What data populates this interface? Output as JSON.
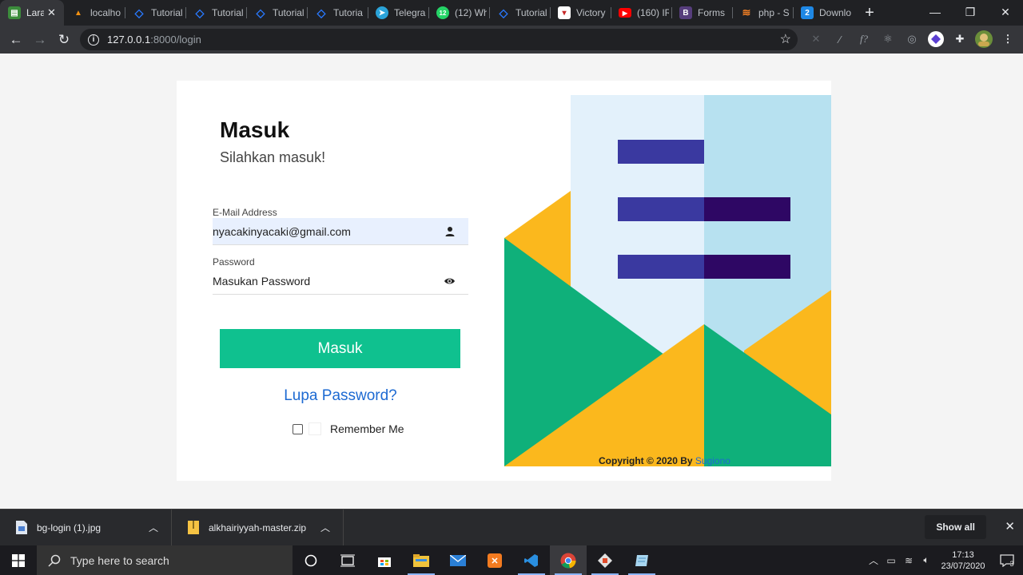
{
  "browser": {
    "tabs": [
      {
        "title": "Lara",
        "favicon_color": "#3c8d3c",
        "active": true
      },
      {
        "title": "localho",
        "favicon_color": "#f29111"
      },
      {
        "title": "Tutorial",
        "favicon_color": "#2979ff"
      },
      {
        "title": "Tutorial",
        "favicon_color": "#2979ff"
      },
      {
        "title": "Tutorial",
        "favicon_color": "#2979ff"
      },
      {
        "title": "Tutoria",
        "favicon_color": "#2979ff"
      },
      {
        "title": "Telegra",
        "favicon_color": "#2aa3d9"
      },
      {
        "title": "(12) Wh",
        "favicon_color": "#25d366"
      },
      {
        "title": "Tutorial",
        "favicon_color": "#2979ff"
      },
      {
        "title": "Victory",
        "favicon_color": "#ffffff"
      },
      {
        "title": "(160) IR",
        "favicon_color": "#ff0000"
      },
      {
        "title": "Forms",
        "favicon_color": "#563d7c"
      },
      {
        "title": "php - S",
        "favicon_color": "#f48024"
      },
      {
        "title": "Downlo",
        "favicon_color": "#1e88e5"
      }
    ],
    "favicon_glyphs": {
      "telegram": "➤",
      "whatsapp": "12",
      "youtube": "▶",
      "bootstrap": "B",
      "download": "2"
    },
    "url_host": "127.0.0.1",
    "url_rest": ":8000/login"
  },
  "page": {
    "title": "Masuk",
    "subtitle": "Silahkan masuk!",
    "email": {
      "label": "E-Mail Address",
      "value": "nyacakinyacaki@gmail.com"
    },
    "password": {
      "label": "Password",
      "placeholder": "Masukan Password"
    },
    "submit_label": "Masuk",
    "forgot_label": "Lupa Password?",
    "remember_label": "Remember Me",
    "copyright_prefix": "Copyright © 2020 By",
    "copyright_author": "Sugiono",
    "colors": {
      "accent": "#0fc18f",
      "link": "#1d6ad2",
      "illustration_green": "#0fb07a",
      "illustration_yellow": "#fbb81d",
      "illustration_navy": "#3a39a0",
      "illustration_purple": "#2e0764"
    }
  },
  "downloads": {
    "items": [
      {
        "name": "bg-login (1).jpg"
      },
      {
        "name": "alkhairiyyah-master.zip"
      }
    ],
    "show_all_label": "Show all"
  },
  "taskbar": {
    "search_placeholder": "Type here to search",
    "time": "17:13",
    "date": "23/07/2020",
    "notification_count": "3"
  }
}
